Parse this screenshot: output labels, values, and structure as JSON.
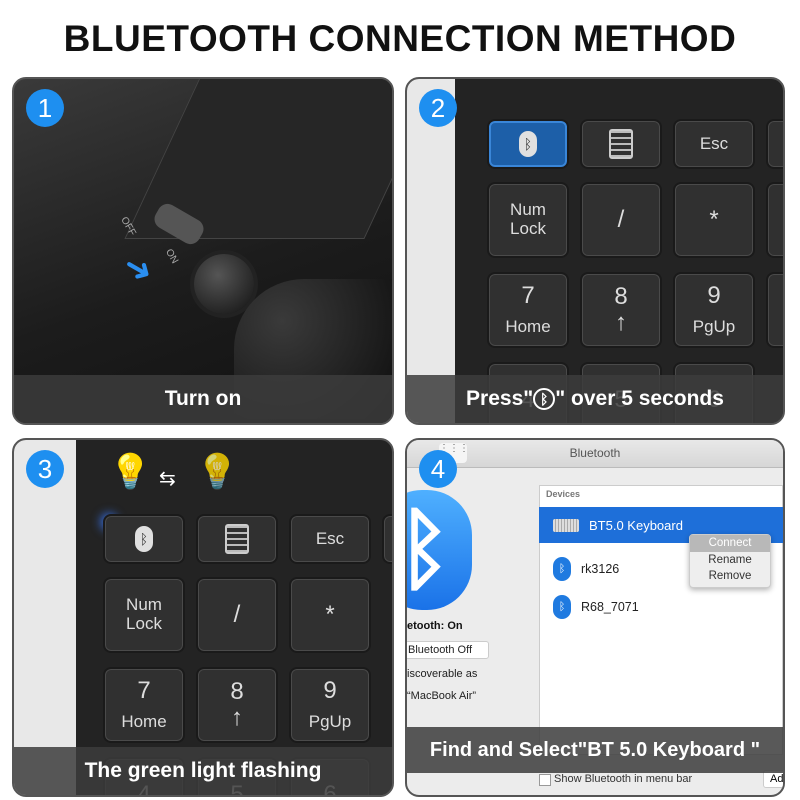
{
  "title": "BLUETOOTH CONNECTION METHOD",
  "colors": {
    "badge": "#1e8ff0",
    "bt_key": "#1d5fa8",
    "selection": "#1e6fd9"
  },
  "steps": [
    {
      "number": "1",
      "caption": "Turn on",
      "switch_labels": [
        "OFF",
        "ON"
      ]
    },
    {
      "number": "2",
      "caption_pre": "Press\"",
      "caption_post": "\" over 5 seconds",
      "caption_icon": "bluetooth-icon"
    },
    {
      "number": "3",
      "caption": "The green light flashing"
    },
    {
      "number": "4",
      "caption": "Find and Select\"BT 5.0 Keyboard \""
    }
  ],
  "keys": {
    "row0": [
      "bluetooth",
      "calculator",
      "Esc"
    ],
    "row1": [
      [
        "Num",
        "Lock"
      ],
      [
        "/"
      ],
      [
        "*"
      ]
    ],
    "row2": [
      [
        "7",
        "Home"
      ],
      [
        "8",
        "↑"
      ],
      [
        "9",
        "PgUp"
      ]
    ],
    "row3": [
      "4",
      "5",
      "6"
    ]
  },
  "bluetooth_window": {
    "title": "Bluetooth",
    "devices_header": "Devices",
    "devices": [
      "BT5.0 Keyboard",
      "rk3126",
      "R68_7071"
    ],
    "context_menu": [
      "Connect",
      "Rename",
      "Remove"
    ],
    "status": "etooth: On",
    "toggle_button": "Bluetooth Off",
    "discoverable": "iscoverable as",
    "name": "“MacBook Air”",
    "footer_checkbox": "Show Bluetooth in menu bar",
    "footer_button": "Ad"
  }
}
